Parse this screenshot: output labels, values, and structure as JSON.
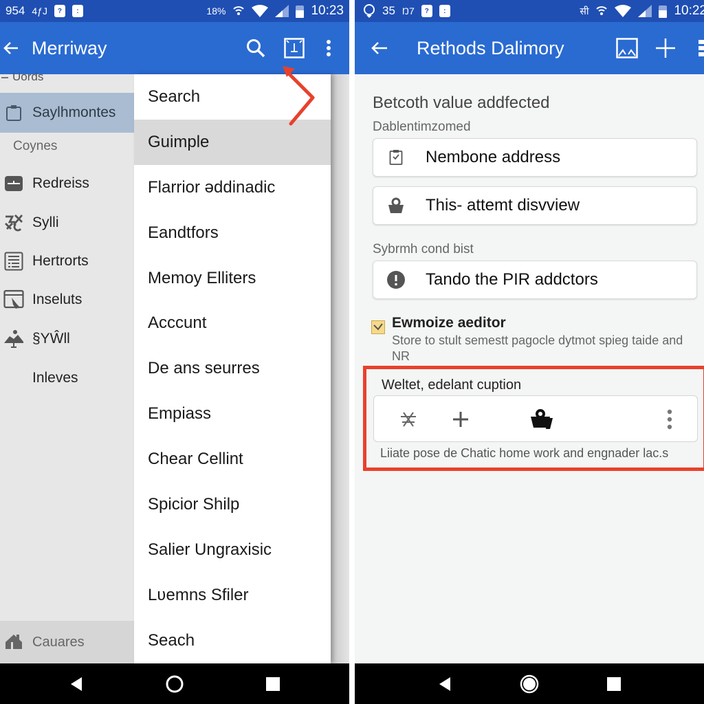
{
  "left_screen": {
    "status_bar": {
      "left_text_1": "954",
      "left_text_2": "4ƒJ",
      "right_text": "18%",
      "time": "10:23"
    },
    "app_bar": {
      "title": "Merriway",
      "back_icon": "arrow-left-icon",
      "actions": [
        "search-icon",
        "crop-frame-icon",
        "more-vert-icon"
      ]
    },
    "drawer": {
      "top_label": "Uords",
      "items": [
        {
          "label": "Saylhmontes",
          "icon": "clipboard-icon",
          "selected": true
        },
        {
          "label": "Coynes",
          "icon": null,
          "subheader": true
        },
        {
          "label": "Redreiss",
          "icon": "toggle-box-icon"
        },
        {
          "label": "Sylli",
          "icon": "tools-icon"
        },
        {
          "label": "Hertrorts",
          "icon": "list-doc-icon"
        },
        {
          "label": "Inseluts",
          "icon": "browser-hand-icon"
        },
        {
          "label": "§YŴll",
          "icon": "landscape-icon"
        },
        {
          "label": "Inleves",
          "icon": null
        }
      ],
      "bottom_item": {
        "label": "Cauares",
        "icon": "home-icon"
      }
    },
    "popup_menu": {
      "highlighted_index": 1,
      "items": [
        "Search",
        "Guimple",
        "Flarrior əddinadic",
        "Eandtfors",
        "Memoy Elliters",
        "Acccunt",
        "De ans seurres",
        "Empiass",
        "Chear Cellint",
        "Spicior Shilp",
        "Salier Ungraxisic",
        "Lʋemns Sfiler",
        "Seach"
      ]
    },
    "annotation_color": "#e8412c"
  },
  "right_screen": {
    "status_bar": {
      "left_text_1": "35",
      "left_text_2": "Ŋ7",
      "right_text": "सी",
      "time": "10:22"
    },
    "app_bar": {
      "title": "Rethods Dalimory",
      "back_icon": "arrow-left-icon",
      "actions": [
        "image-frame-icon",
        "add-icon",
        "more-vert-icon"
      ]
    },
    "section_title": "Betcoth value addfected",
    "fields": [
      {
        "label": "Dablentimzomed",
        "value": "Nembone address",
        "icon": "clipboard-check-icon"
      },
      {
        "label": null,
        "value": "This- attemt disvview",
        "icon": "basket-icon"
      },
      {
        "label": "Sybrmh cond bist",
        "value": "Tando the PIR addctors",
        "icon": "alert-circle-icon"
      }
    ],
    "checkbox": {
      "checked": true,
      "title": "Ewmoize aeditor",
      "description": "Store to stult semestt pagocle dytmot spieg taide and NR"
    },
    "highlight_box": {
      "title": "Weltet, edelant cuption",
      "toolbar_icons": [
        "tools-icon",
        "add-icon",
        "bag-icon",
        "more-vert-icon"
      ],
      "description": "Liiate pose de Chatic home work and engnader lac.s",
      "border_color": "#e8412c"
    }
  },
  "nav_bar": {
    "buttons": [
      "back-triangle-icon",
      "home-circle-icon",
      "recents-square-icon"
    ]
  },
  "colors": {
    "status_bar": "#1f4fb3",
    "app_bar": "#2a6bd1",
    "selected_drawer": "#a9bcd1"
  }
}
